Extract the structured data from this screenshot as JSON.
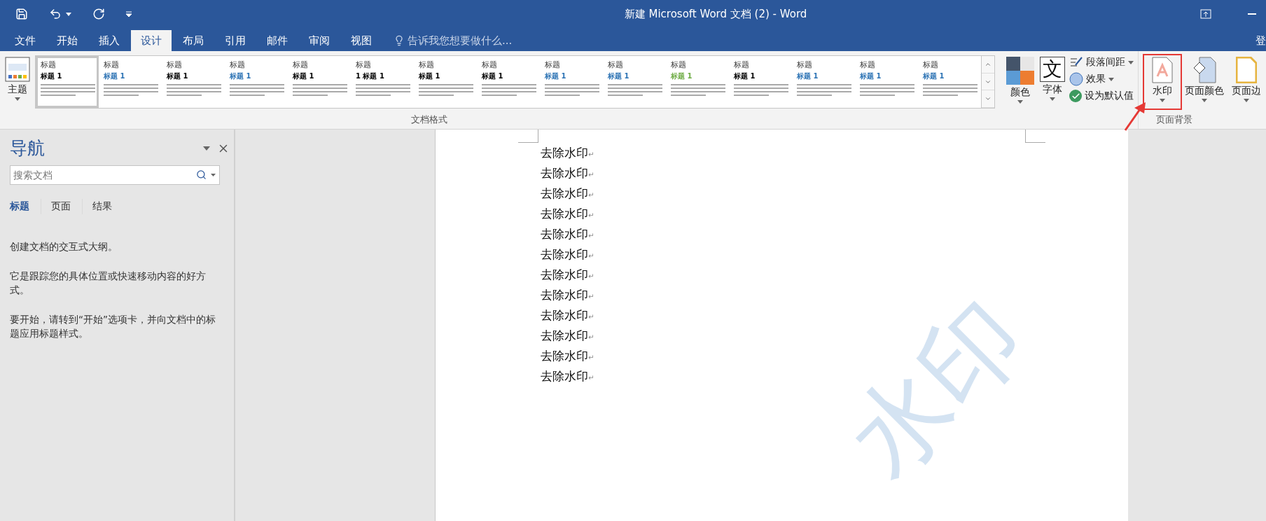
{
  "window": {
    "title": "新建 Microsoft Word 文档 (2) - Word"
  },
  "tabs": [
    {
      "label": "文件",
      "selected": false
    },
    {
      "label": "开始",
      "selected": false
    },
    {
      "label": "插入",
      "selected": false
    },
    {
      "label": "设计",
      "selected": true
    },
    {
      "label": "布局",
      "selected": false
    },
    {
      "label": "引用",
      "selected": false
    },
    {
      "label": "邮件",
      "selected": false
    },
    {
      "label": "审阅",
      "selected": false
    },
    {
      "label": "视图",
      "selected": false
    }
  ],
  "tell_me": {
    "placeholder": "告诉我您想要做什么..."
  },
  "sign_in": "登",
  "ribbon": {
    "themes": "主题",
    "gallery": [
      {
        "title": "标题",
        "heading": "标题 1",
        "color": "#000000",
        "selected": true
      },
      {
        "title": "标题",
        "heading": "标题 1",
        "color": "#2e74b5",
        "selected": false
      },
      {
        "title": "标题",
        "heading": "标题 1",
        "color": "#000000",
        "selected": false
      },
      {
        "title": "标题",
        "heading": "标题 1",
        "color": "#2e74b5",
        "selected": false
      },
      {
        "title": "标题",
        "heading": "标题 1",
        "color": "#000000",
        "selected": false
      },
      {
        "title": "标题",
        "heading": "1 标题 1",
        "color": "#000000",
        "selected": false
      },
      {
        "title": "标题",
        "heading": "标题 1",
        "color": "#000000",
        "selected": false
      },
      {
        "title": "标题",
        "heading": "标题 1",
        "color": "#000000",
        "selected": false
      },
      {
        "title": "标题",
        "heading": "标题 1",
        "color": "#2e74b5",
        "selected": false
      },
      {
        "title": "标题",
        "heading": "标题 1",
        "color": "#2e74b5",
        "selected": false
      },
      {
        "title": "标题",
        "heading": "标题 1",
        "color": "#70ad47",
        "selected": false
      },
      {
        "title": "标题",
        "heading": "标题 1",
        "color": "#000000",
        "selected": false
      },
      {
        "title": "标题",
        "heading": "标题 1",
        "color": "#2e74b5",
        "selected": false
      },
      {
        "title": "标题",
        "heading": "标题 1",
        "color": "#2e74b5",
        "selected": false
      },
      {
        "title": "标题",
        "heading": "标题 1",
        "color": "#2e74b5",
        "selected": false
      }
    ],
    "colors": "颜色",
    "fonts": "字体",
    "fonts_glyph": "文",
    "small_buttons": [
      {
        "kind": "spacing",
        "label": "段落间距"
      },
      {
        "kind": "effects",
        "label": "效果"
      },
      {
        "kind": "default",
        "label": "设为默认值"
      }
    ],
    "format_group": "文档格式",
    "background_buttons": [
      {
        "kind": "watermark",
        "label": "水印",
        "highlighted": true
      },
      {
        "kind": "page_color",
        "label": "页面颜色",
        "highlighted": false
      },
      {
        "kind": "page_borders",
        "label": "页面边",
        "highlighted": false
      }
    ],
    "background_group": "页面背景"
  },
  "navigation": {
    "title": "导航",
    "search": {
      "placeholder": "搜索文档"
    },
    "tabs": [
      {
        "label": "标题",
        "selected": true
      },
      {
        "label": "页面",
        "selected": false
      },
      {
        "label": "结果",
        "selected": false
      }
    ],
    "paragraphs": [
      "创建文档的交互式大纲。",
      "它是跟踪您的具体位置或快速移动内容的好方式。",
      "要开始，请转到“开始”选项卡，并向文档中的标题应用标题样式。"
    ]
  },
  "document": {
    "paragraph_mark": "↵",
    "watermark": "水印",
    "lines": [
      "去除水印",
      "去除水印",
      "去除水印",
      "去除水印",
      "去除水印",
      "去除水印",
      "去除水印",
      "去除水印",
      "去除水印",
      "去除水印",
      "去除水印",
      "去除水印"
    ]
  }
}
